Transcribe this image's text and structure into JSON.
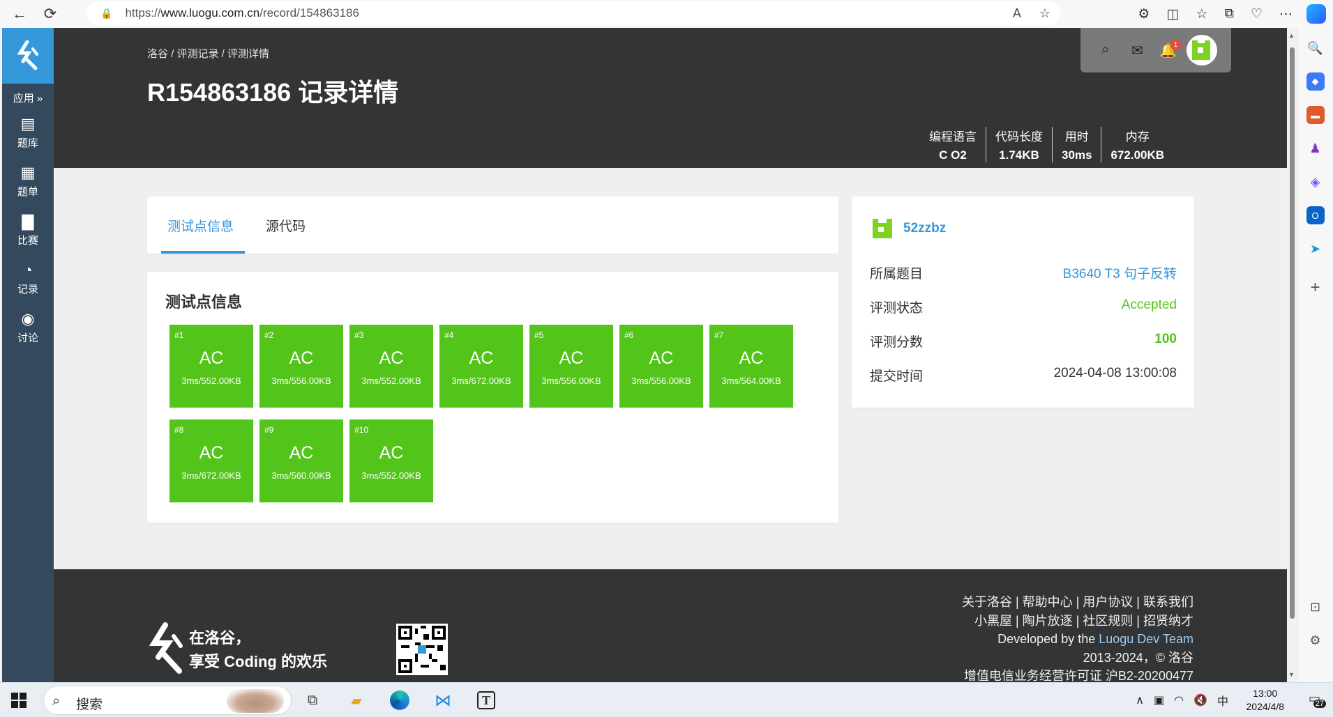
{
  "browser": {
    "url_prefix": "https://",
    "url_host": "www.luogu.com.cn",
    "url_path": "/record/154863186",
    "back_icon": "←",
    "reload_icon": "⟳",
    "read_aloud": "A",
    "favorite_icon": "☆"
  },
  "app_nav": {
    "apps_label": "应用 »",
    "items": [
      {
        "label": "题库",
        "icon": "▤"
      },
      {
        "label": "题单",
        "icon": "▦"
      },
      {
        "label": "比赛",
        "icon": "▇"
      },
      {
        "label": "记录",
        "icon": "◔"
      },
      {
        "label": "讨论",
        "icon": "◉"
      }
    ]
  },
  "header": {
    "breadcrumb": "洛谷 / 评测记录 / 评测详情",
    "title": "R154863186 记录详情",
    "notification_count": "1",
    "stats": [
      {
        "label": "编程语言",
        "value": "C O2"
      },
      {
        "label": "代码长度",
        "value": "1.74KB"
      },
      {
        "label": "用时",
        "value": "30ms"
      },
      {
        "label": "内存",
        "value": "672.00KB"
      }
    ]
  },
  "tabs": {
    "testcases": "测试点信息",
    "source": "源代码"
  },
  "testcases": {
    "title": "测试点信息",
    "items": [
      {
        "num": "#1",
        "result": "AC",
        "info": "3ms/552.00KB"
      },
      {
        "num": "#2",
        "result": "AC",
        "info": "3ms/556.00KB"
      },
      {
        "num": "#3",
        "result": "AC",
        "info": "3ms/552.00KB"
      },
      {
        "num": "#4",
        "result": "AC",
        "info": "3ms/672.00KB"
      },
      {
        "num": "#5",
        "result": "AC",
        "info": "3ms/556.00KB"
      },
      {
        "num": "#6",
        "result": "AC",
        "info": "3ms/556.00KB"
      },
      {
        "num": "#7",
        "result": "AC",
        "info": "3ms/564.00KB"
      },
      {
        "num": "#8",
        "result": "AC",
        "info": "3ms/672.00KB"
      },
      {
        "num": "#9",
        "result": "AC",
        "info": "3ms/560.00KB"
      },
      {
        "num": "#10",
        "result": "AC",
        "info": "3ms/552.00KB"
      }
    ],
    "ac_color": "#52c41a"
  },
  "record_info": {
    "username": "52zzbz",
    "rows": {
      "problem_label": "所属题目",
      "problem_value": "B3640 T3 句子反转",
      "status_label": "评测状态",
      "status_value": "Accepted",
      "score_label": "评测分数",
      "score_value": "100",
      "time_label": "提交时间",
      "time_value": "2024-04-08 13:00:08"
    }
  },
  "footer": {
    "slogan_line1": "在洛谷，",
    "slogan_line2": "享受 Coding 的欢乐",
    "links_row1": "关于洛谷 | 帮助中心 | 用户协议 | 联系我们",
    "links_row2": "小黑屋 | 陶片放逐 | 社区规则 | 招贤纳才",
    "dev_prefix": "Developed by the ",
    "dev_team": "Luogu Dev Team",
    "copyright": "2013-2024，© 洛谷",
    "icp": "增值电信业务经营许可证 沪B2-20200477"
  },
  "taskbar": {
    "search_label": "搜索",
    "ime": "中",
    "time": "13:00",
    "date": "2024/4/8",
    "notification_count": "27"
  },
  "colors": {
    "brand_blue": "#3498db",
    "header_dark": "#333436",
    "nav_dark": "#34495e",
    "accepted_green": "#52c41a"
  }
}
